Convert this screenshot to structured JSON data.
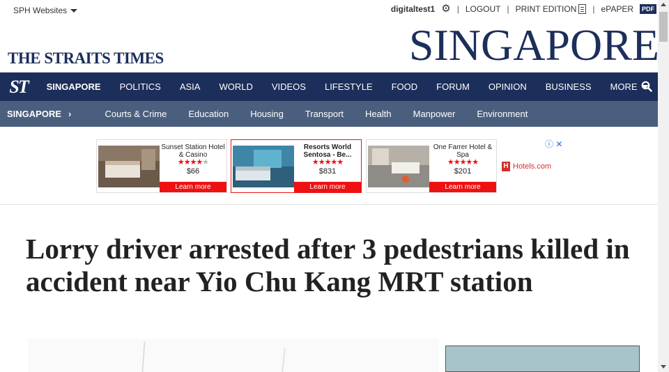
{
  "utility_bar": {
    "sph_label": "SPH Websites",
    "username": "digitaltest1",
    "logout": "LOGOUT",
    "print_edition": "PRINT EDITION",
    "epaper": "ePAPER",
    "pdf": "PDF"
  },
  "masthead": {
    "brand": "THE STRAITS TIMES",
    "section": "SINGAPORE",
    "color": "#1c2e5a"
  },
  "nav": {
    "logo": "ST",
    "items": [
      "SINGAPORE",
      "POLITICS",
      "ASIA",
      "WORLD",
      "VIDEOS",
      "LIFESTYLE",
      "FOOD",
      "FORUM",
      "OPINION",
      "BUSINESS"
    ],
    "more": "MORE",
    "search_icon": "search-icon"
  },
  "subnav": {
    "title": "SINGAPORE",
    "chevron": "›",
    "items": [
      "Courts & Crime",
      "Education",
      "Housing",
      "Transport",
      "Health",
      "Manpower",
      "Environment"
    ]
  },
  "ads": {
    "hotels": [
      {
        "name": "Sunset Station Hotel & Casino",
        "rating": 4,
        "price": "$66",
        "cta": "Learn more"
      },
      {
        "name": "Resorts World Sentosa - Be...",
        "rating": 5,
        "price": "$831",
        "cta": "Learn more"
      },
      {
        "name": "One Farrer Hotel & Spa",
        "rating": 5,
        "price": "$201",
        "cta": "Learn more"
      }
    ],
    "advertiser": "Hotels.com",
    "adchoices": "ⓘ ✕"
  },
  "article": {
    "headline": "Lorry driver arrested after 3 pedestrians killed in accident near Yio Chu Kang MRT station"
  }
}
